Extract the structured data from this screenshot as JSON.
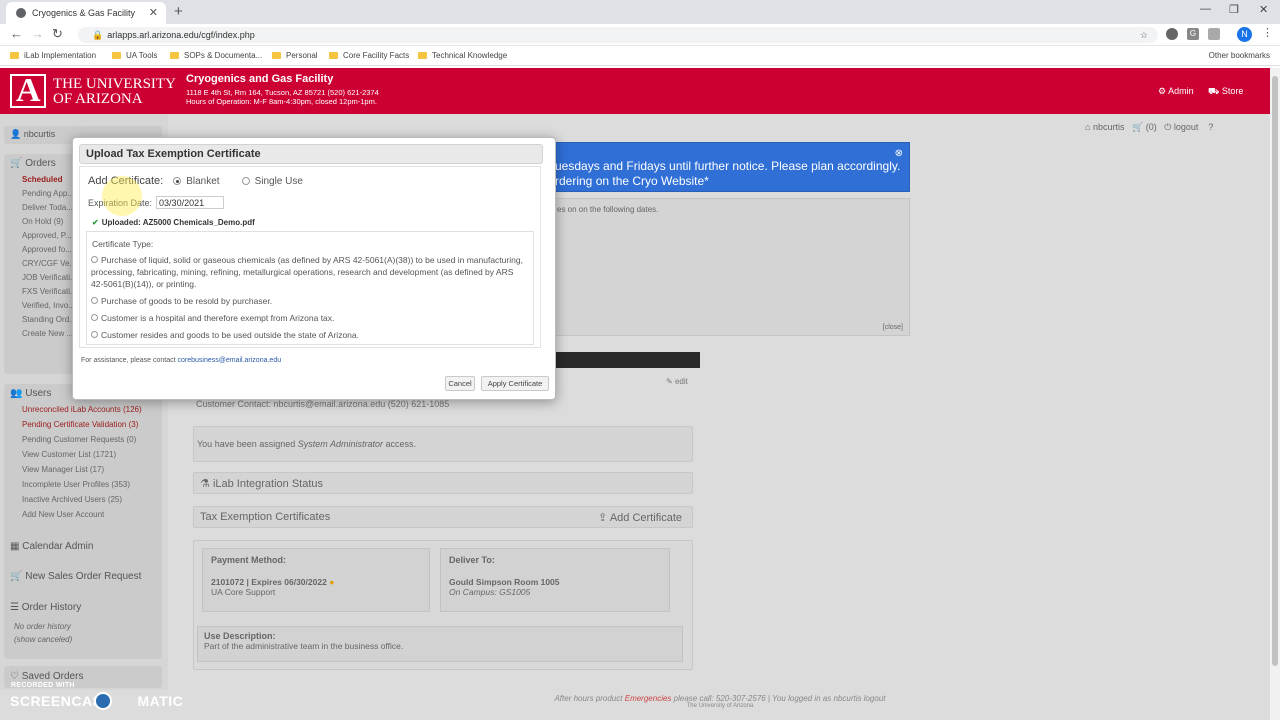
{
  "browser": {
    "tab_title": "Cryogenics & Gas Facility",
    "url": "arlapps.arl.arizona.edu/cgf/index.php",
    "profile_initial": "N",
    "bookmarks": [
      "iLab Implementation",
      "UA Tools",
      "SOPs & Documenta...",
      "Personal",
      "Core Facility Facts",
      "Technical Knowledge"
    ],
    "other_bookmarks": "Other bookmarks"
  },
  "site": {
    "university_line1": "THE UNIVERSITY",
    "university_line2": "OF ARIZONA",
    "facility_title": "Cryogenics and Gas Facility",
    "facility_address": "1118 E 4th St, Rm 164, Tucson, AZ 85721   (520) 621-2374",
    "facility_hours": "Hours of Operation: M-F 8am-4:30pm, closed 12pm-1pm.",
    "admin_label": "Admin",
    "store_label": "Store",
    "user_bar": {
      "user": "nbcurtis",
      "cart": "(0)",
      "logout": "logout"
    }
  },
  "sidebar": {
    "user_label": "nbcurtis",
    "orders_heading": "Orders",
    "orders_items": [
      "Scheduled",
      "Pending App...",
      "Deliver Toda...",
      "On Hold (9)",
      "Approved, P...",
      "Approved fo... (120)",
      "CRY/CGF Ve... (805)",
      "JOB Verificati...",
      "FXS Verificati...",
      "Verified, Invo...",
      "Standing Ord...",
      "Create New ..."
    ],
    "users_heading": "Users",
    "users_items": [
      "Unreconciled iLab Accounts (126)",
      "Pending Certificate Validation (3)",
      "Pending Customer Requests (0)",
      "View Customer List (1721)",
      "View Manager List (17)",
      "Incomplete User Profiles (353)",
      "Inactive Archived Users (25)",
      "Add New User Account"
    ],
    "calendar_admin": "Calendar Admin",
    "new_sales_order": "New Sales Order Request",
    "order_history": "Order History",
    "no_history": "No order history",
    "show_canceled": "(show canceled)",
    "saved_orders": "Saved Orders"
  },
  "main": {
    "banner_line1": "uesdays and Fridays until further notice. Please plan accordingly.",
    "banner_line2": "rdering on the Cryo Website*",
    "notice_text": "es on on the following dates.",
    "notice_close": "[close]",
    "edit_label": "edit",
    "customer_contact": "Customer Contact: nbcurtis@email.arizona.edu     (520) 621-1085",
    "assigned_prefix": "You have been assigned ",
    "assigned_role": "System Administrator",
    "assigned_suffix": " access.",
    "ilab_status": "iLab Integration Status",
    "tax_exempt_title": "Tax Exemption Certificates",
    "add_certificate": "Add Certificate",
    "payment_method_label": "Payment Method:",
    "payment_method_value": "2101072 | Expires 06/30/2022",
    "payment_method_sub": "UA Core Support",
    "deliver_to_label": "Deliver To:",
    "deliver_to_value": "Gould Simpson Room 1005",
    "deliver_to_sub": "On Campus: GS1005",
    "use_desc_label": "Use Description:",
    "use_desc_value": "Part of the administrative team in the business office."
  },
  "footer": {
    "prefix": "After hours product ",
    "emergencies": "Emergencies",
    "suffix": " please call: 520-307-2576     |     You logged in as nbcurtis     logout",
    "copyright": "The University of Arizona"
  },
  "modal": {
    "title": "Upload Tax Exemption Certificate",
    "add_cert_label": "Add Certificate:",
    "option_blanket": "Blanket",
    "option_single": "Single Use",
    "selected_option": "Blanket",
    "expiration_label": "Expiration Date:",
    "expiration_value": "03/30/2021",
    "uploaded_text": "Uploaded: AZ5000 Chemicals_Demo.pdf",
    "cert_type_label": "Certificate Type:",
    "cert_options": [
      "Purchase of liquid, solid or gaseous chemicals (as defined by ARS 42-5061(A)(38)) to be used in manufacturing, processing, fabricating, mining, refining, metallurgical operations, research and development (as defined by ARS 42-5061(B)(14)), or printing.",
      "Purchase of goods to be resold by purchaser.",
      "Customer is a hospital and therefore exempt from Arizona tax.",
      "Customer resides and goods to be used outside the state of Arizona."
    ],
    "assist_text": "For assistance, please contact ",
    "assist_email": "corebusiness@email.arizona.edu",
    "cancel_label": "Cancel",
    "apply_label": "Apply Certificate"
  },
  "watermark": {
    "recorded_with": "RECORDED WITH",
    "brand": "SCREENCAST",
    "brand_suffix": "MATIC"
  },
  "colors": {
    "ua_red": "#cc0033",
    "banner_blue": "#2f6fd6"
  }
}
